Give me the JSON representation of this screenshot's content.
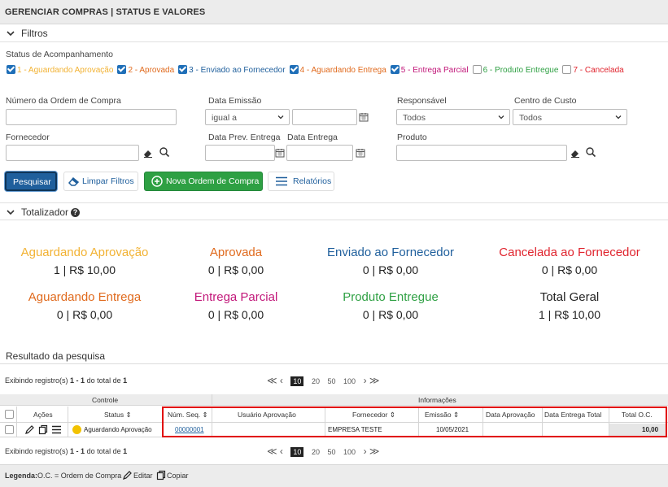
{
  "page": {
    "title": "GERENCIAR COMPRAS | STATUS E VALORES"
  },
  "filters": {
    "section_title": "Filtros",
    "status_label": "Status de Acompanhamento",
    "statuses": [
      {
        "label": "1 - Aguardando Aprovação",
        "checked": true,
        "color": "#f2b233"
      },
      {
        "label": "2 - Aprovada",
        "checked": true,
        "color": "#e06a1d"
      },
      {
        "label": "3 - Enviado ao Fornecedor",
        "checked": true,
        "color": "#1f5f9c"
      },
      {
        "label": "4 - Aguardando Entrega",
        "checked": true,
        "color": "#e06a1d"
      },
      {
        "label": "5 - Entrega Parcial",
        "checked": true,
        "color": "#c2187a"
      },
      {
        "label": "6 - Produto Entregue",
        "checked": false,
        "color": "#2ea043"
      },
      {
        "label": "7 - Cancelada",
        "checked": false,
        "color": "#e0242e"
      }
    ],
    "num_ordem_label": "Número da Ordem de Compra",
    "fornecedor_label": "Fornecedor",
    "data_emissao_label": "Data Emissão",
    "data_emissao_op": "igual a",
    "data_prev_label": "Data Prev. Entrega",
    "data_entrega_label": "Data Entrega",
    "responsavel_label": "Responsável",
    "responsavel_value": "Todos",
    "centro_label": "Centro de Custo",
    "centro_value": "Todos",
    "produto_label": "Produto"
  },
  "buttons": {
    "pesquisar": "Pesquisar",
    "limpar": "Limpar Filtros",
    "nova": "Nova Ordem de Compra",
    "relatorios": "Relatórios"
  },
  "totalizador": {
    "title": "Totalizador",
    "items": [
      {
        "title": "Aguardando Aprovação",
        "value": "1 | R$ 10,00",
        "color": "#f2b233"
      },
      {
        "title": "Aprovada",
        "value": "0 | R$ 0,00",
        "color": "#e06a1d"
      },
      {
        "title": "Enviado ao Fornecedor",
        "value": "0 | R$ 0,00",
        "color": "#1f5f9c"
      },
      {
        "title": "Cancelada ao Fornecedor",
        "value": "0 | R$ 0,00",
        "color": "#e0242e"
      },
      {
        "title": "Aguardando Entrega",
        "value": "0 | R$ 0,00",
        "color": "#e06a1d"
      },
      {
        "title": "Entrega Parcial",
        "value": "0 | R$ 0,00",
        "color": "#c2187a"
      },
      {
        "title": "Produto Entregue",
        "value": "0 | R$ 0,00",
        "color": "#2ea043"
      },
      {
        "title": "Total Geral",
        "value": "1 | R$ 10,00",
        "color": "#222222"
      }
    ]
  },
  "results": {
    "title": "Resultado da pesquisa",
    "showing_prefix": "Exibindo registro(s)",
    "showing_range": "1 - 1",
    "showing_mid": "do total de",
    "showing_total": "1",
    "pager": {
      "prev": "≪ ‹",
      "pages": [
        "10",
        "20",
        "50",
        "100"
      ],
      "current": "10",
      "next": "› ≫"
    },
    "groups": {
      "controle": "Controle",
      "informacoes": "Informações"
    },
    "columns": {
      "acoes": "Ações",
      "status": "Status ⇕",
      "num_seq": "Núm. Seq. ⇕",
      "usuario": "Usuário Aprovação",
      "fornecedor": "Fornecedor ⇕",
      "emissao": "Emissão ⇕",
      "data_aprov": "Data Aprovação",
      "data_entrega_total": "Data Entrega Total",
      "total_oc": "Total O.C."
    },
    "row": {
      "status": "Aguardando Aprovação",
      "status_color": "#f2c200",
      "num_seq": "00000001",
      "usuario": "",
      "fornecedor": "EMPRESA TESTE",
      "emissao": "10/05/2021",
      "data_aprov": "",
      "data_entrega_total": "",
      "total_oc": "10,00"
    }
  },
  "legend": {
    "label": "Legenda:",
    "oc": "O.C. = Ordem de Compra",
    "editar": "Editar",
    "copiar": "Copiar"
  }
}
